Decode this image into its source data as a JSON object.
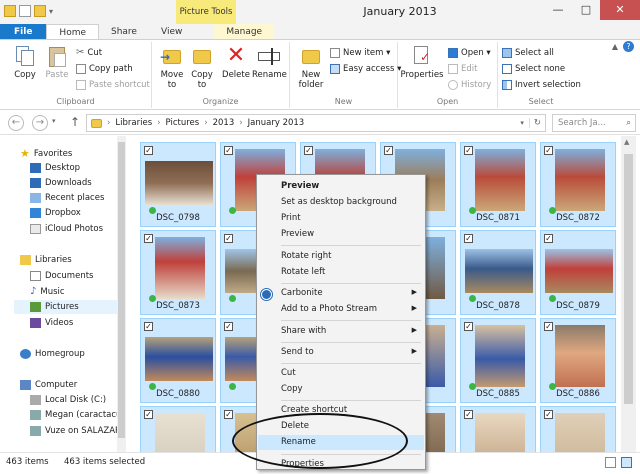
{
  "window": {
    "title": "January 2013",
    "context_tab_header": "Picture Tools",
    "controls": {
      "minimize": "—",
      "maximize": "□",
      "close": "✕"
    }
  },
  "tabs": [
    "File",
    "Home",
    "Share",
    "View",
    "Manage"
  ],
  "ribbon": {
    "clipboard": {
      "label": "Clipboard",
      "copy": "Copy",
      "paste": "Paste",
      "cut": "Cut",
      "copy_path": "Copy path",
      "paste_shortcut": "Paste shortcut"
    },
    "organize": {
      "label": "Organize",
      "move_to": "Move to",
      "copy_to": "Copy to",
      "delete": "Delete",
      "rename": "Rename"
    },
    "new": {
      "label": "New",
      "new_folder": "New folder",
      "new_item": "New item ▾",
      "easy_access": "Easy access ▾"
    },
    "open": {
      "label": "Open",
      "properties": "Properties",
      "open": "Open ▾",
      "edit": "Edit",
      "history": "History"
    },
    "select": {
      "label": "Select",
      "select_all": "Select all",
      "select_none": "Select none",
      "invert_selection": "Invert selection"
    }
  },
  "address": {
    "crumbs": [
      "Libraries",
      "Pictures",
      "2013",
      "January 2013"
    ],
    "search_placeholder": "Search Ja..."
  },
  "nav": {
    "favorites": "Favorites",
    "desktop": "Desktop",
    "downloads": "Downloads",
    "recent_places": "Recent places",
    "dropbox": "Dropbox",
    "icloud_photos": "iCloud Photos",
    "libraries": "Libraries",
    "documents": "Documents",
    "music": "Music",
    "pictures": "Pictures",
    "videos": "Videos",
    "homegroup": "Homegroup",
    "computer": "Computer",
    "local_disk": "Local Disk (C:)",
    "megan": "Megan (caractacus",
    "vuze": "Vuze on SALAZAR"
  },
  "files": {
    "r1": [
      "DSC_0798",
      "",
      "",
      "70",
      "DSC_0871",
      "DSC_0872"
    ],
    "r2": [
      "DSC_0873",
      "",
      "",
      "76",
      "DSC_0878",
      "DSC_0879"
    ],
    "r3": [
      "DSC_0880",
      "",
      "",
      "",
      "DSC_0885",
      "DSC_0886"
    ],
    "check": "✓"
  },
  "context_menu": {
    "preview_bold": "Preview",
    "set_desktop_bg": "Set as desktop background",
    "print": "Print",
    "preview": "Preview",
    "rotate_right": "Rotate right",
    "rotate_left": "Rotate left",
    "carbonite": "Carbonite",
    "add_photo_stream": "Add to a Photo Stream",
    "share_with": "Share with",
    "send_to": "Send to",
    "cut": "Cut",
    "copy": "Copy",
    "create_shortcut": "Create shortcut",
    "delete": "Delete",
    "rename": "Rename",
    "properties": "Properties"
  },
  "status": {
    "item_count": "463 items",
    "selected": "463 items selected"
  }
}
